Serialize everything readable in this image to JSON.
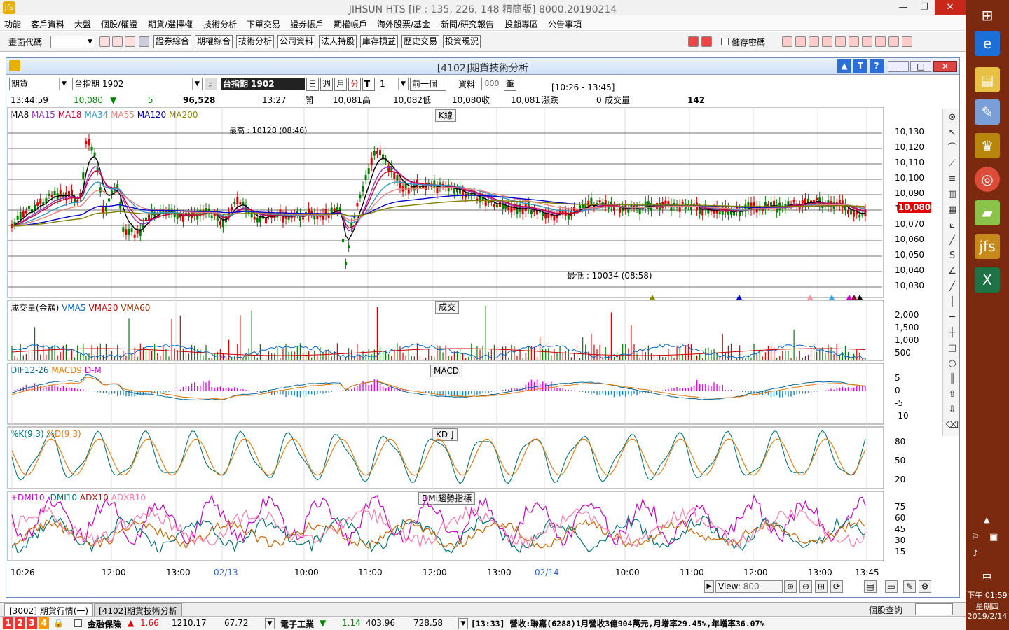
{
  "app": {
    "title": "JIHSUN HTS    [IP : 135, 226, 148 精簡版] 8000.20190214"
  },
  "menu": [
    "功能",
    "客戶資料",
    "大盤",
    "個股/權證",
    "期貨/選擇權",
    "技術分析",
    "下單交易",
    "證券帳戶",
    "期權帳戶",
    "海外股票/基金",
    "新聞/研究報告",
    "投顧專區",
    "公告事項"
  ],
  "toolbar": {
    "code_label": "畫面代碼",
    "buttons": [
      "證券綜合",
      "期權綜合",
      "技術分析",
      "公司資料",
      "法人持股",
      "庫存損益",
      "歷史交易",
      "投資現況"
    ],
    "save_pwd": "儲存密碼"
  },
  "inner": {
    "title": "[4102]期貨技術分析"
  },
  "controls": {
    "market": "期貨",
    "symbol": "台指期 1902",
    "symbol_tag": "台指期 1902",
    "periods": [
      "日",
      "週",
      "月",
      "分",
      "T"
    ],
    "interval": "1",
    "prev_btn": "前一個",
    "data_label": "資料",
    "data_count": "800",
    "unit": "筆",
    "time_range": "[10:26 - 13:45]"
  },
  "quote": {
    "time": "13:44:59",
    "price": "10,080",
    "change": "5",
    "volume_total": "96,528",
    "bar_time": "13:27",
    "open_label": "開",
    "open": "10,081",
    "high_label": "高",
    "high": "10,082",
    "low_label": "低",
    "low": "10,080",
    "close_label": "收",
    "close": "10,081",
    "chg_label": "漲跌",
    "chg": "0",
    "vol_label": "成交量",
    "vol": "142"
  },
  "colors": {
    "up": "#e00000",
    "down": "#008000",
    "ma8": "#000000",
    "ma15": "#9933cc",
    "ma18": "#cc0033",
    "ma34": "#3399cc",
    "ma55": "#f08080",
    "ma120": "#0000cc",
    "ma200": "#808000",
    "price_tag": "#e00000"
  },
  "kline": {
    "tag": "K線",
    "legend": [
      "MA8",
      "MA15",
      "MA18",
      "MA34",
      "MA55",
      "MA120",
      "MA200"
    ],
    "high_note": "最高 : 10128 (08:46)",
    "low_note": "最低 : 10034 (08:58)",
    "price_tag": "10,080",
    "yticks": [
      "10,130",
      "10,120",
      "10,110",
      "10,100",
      "10,090",
      "10,080",
      "10,070",
      "10,060",
      "10,050",
      "10,040",
      "10,030"
    ]
  },
  "volume": {
    "tag": "成交",
    "legend": [
      "成交量(金額)",
      "VMA5",
      "VMA20",
      "VMA60"
    ],
    "yticks": [
      "2,000",
      "1,500",
      "1,000",
      "500"
    ]
  },
  "macd": {
    "tag": "MACD",
    "legend": [
      "DIF12-26",
      "MACD9",
      "D-M"
    ],
    "yticks": [
      "5",
      "0",
      "-5",
      "-10"
    ]
  },
  "kd": {
    "tag": "KD-J",
    "legend": [
      "%K(9,3)",
      "%D(9,3)"
    ],
    "yticks": [
      "80",
      "50",
      "20"
    ]
  },
  "dmi": {
    "tag": "DMI趨勢指標",
    "legend": [
      "+DMI10",
      "-DMI10",
      "ADX10",
      "ADXR10"
    ],
    "yticks": [
      "75",
      "60",
      "45",
      "30",
      "15"
    ]
  },
  "xaxis": [
    "10:26",
    "12:00",
    "13:00",
    "02/13",
    "10:00",
    "11:00",
    "12:00",
    "13:00",
    "02/14",
    "10:00",
    "11:00",
    "12:00",
    "13:00",
    "13:45"
  ],
  "view": {
    "label": "View:",
    "value": "800"
  },
  "tabs": [
    "[3002] 期貨行情(一)",
    "[4102]期貨技術分析"
  ],
  "stock_query": "個股查詢",
  "ticker": {
    "sector1": "金融保險",
    "s1_chg": "1.66",
    "s1_idx": "1210.17",
    "s1_vol": "67.72",
    "sector2": "電子工業",
    "s2_chg": "1.14",
    "s2_idx": "403.96",
    "s2_vol": "728.58",
    "news": "[13:33] 營收:聯嘉(6288)1月營收3億904萬元,月增率29.45%,年增率36.07%"
  },
  "pages": [
    "1",
    "2",
    "3",
    "4"
  ],
  "clock": {
    "time": "下午 01:59",
    "day": "星期四",
    "date": "2019/2/14",
    "ime": "中"
  }
}
